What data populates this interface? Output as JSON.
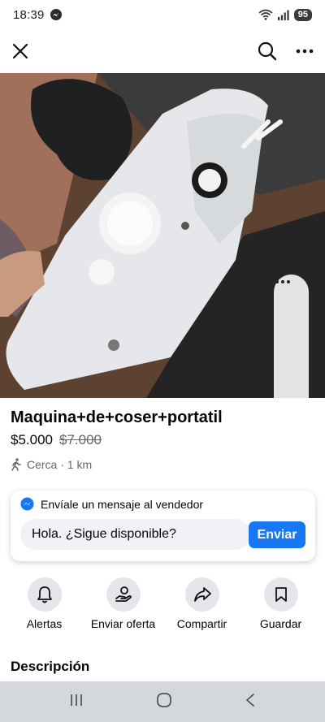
{
  "status_bar": {
    "time": "18:39",
    "battery": "95"
  },
  "top_bar": {
    "icons": [
      "close-icon",
      "search-icon",
      "more-icon"
    ]
  },
  "listing": {
    "title": "Maquina+de+coser+portatil",
    "price": "$5.000",
    "old_price": "$7.000",
    "location": "Cerca · 1 km"
  },
  "message": {
    "heading": "Envíale un mensaje al vendedor",
    "input_value": "Hola. ¿Sigue disponible?",
    "send_label": "Enviar"
  },
  "actions": [
    {
      "label": "Alertas",
      "icon": "bell-icon"
    },
    {
      "label": "Enviar oferta",
      "icon": "offer-icon"
    },
    {
      "label": "Compartir",
      "icon": "share-icon"
    },
    {
      "label": "Guardar",
      "icon": "bookmark-icon"
    }
  ],
  "description_title": "Descripción",
  "colors": {
    "accent": "#1877f2",
    "secondary_text": "#65676b",
    "icon_bg": "#e4e6eb",
    "nav_bar": "#d4d7dc"
  }
}
